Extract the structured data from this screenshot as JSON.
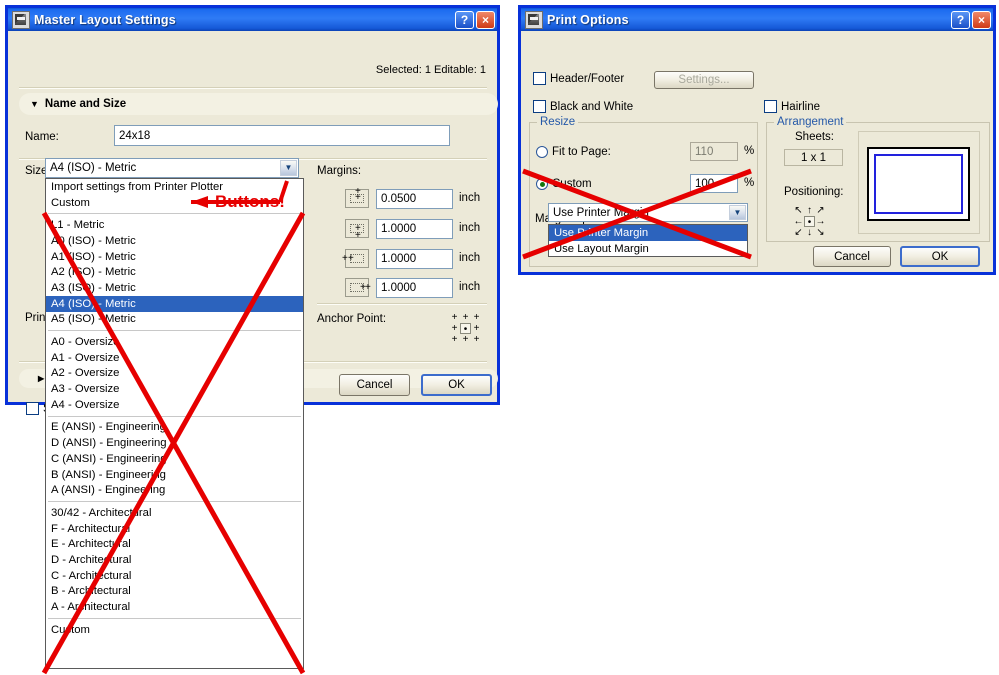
{
  "colors": {
    "accent_blue": "#0831d9",
    "dialog_face": "#ece9d8",
    "selection_blue": "#2c63bd",
    "group_title_blue": "#2458a8",
    "annotation_red": "#e60000",
    "preview_border_blue": "#2222dd"
  },
  "master_layout_dialog": {
    "title": "Master Layout Settings",
    "help_label": "?",
    "close_label": "×",
    "status_text": "Selected: 1 Editable: 1",
    "rollup": {
      "arrow": "▼",
      "label": "Name and Size"
    },
    "name_label": "Name:",
    "name_value": "24x18",
    "size_label": "Size:",
    "size_selected": "A4 (ISO) - Metric",
    "size_options": [
      "Import settings from Printer Plotter",
      "Custom",
      "L1 - Metric",
      "A0 (ISO) - Metric",
      "A1 (ISO) - Metric",
      "A2 (ISO) - Metric",
      "A3 (ISO) - Metric",
      "A4 (ISO) - Metric",
      "A5 (ISO) - Metric",
      "A0 - Oversize",
      "A1 - Oversize",
      "A2 - Oversize",
      "A3 - Oversize",
      "A4 - Oversize",
      "E (ANSI) - Engineering",
      "D (ANSI) - Engineering",
      "C (ANSI) - Engineering",
      "B (ANSI) - Engineering",
      "A (ANSI) - Engineering",
      "30/42 - Architectural",
      "F - Architectural",
      "E - Architectural",
      "D - Architectural",
      "C - Architectural",
      "B - Architectural",
      "A - Architectural",
      "Custom"
    ],
    "margins_label": "Margins:",
    "margins": [
      {
        "icon": "margin-top-icon",
        "value": "0.0500",
        "unit": "inch"
      },
      {
        "icon": "margin-bottom-icon",
        "value": "1.0000",
        "unit": "inch"
      },
      {
        "icon": "margin-left-icon",
        "value": "1.0000",
        "unit": "inch"
      },
      {
        "icon": "margin-right-icon",
        "value": "1.0000",
        "unit": "inch"
      }
    ],
    "anchor_label": "Anchor Point:",
    "printer_label": "Print",
    "collapsed_arrow": "▶",
    "bottom_checkbox_label": "S",
    "cancel_label": "Cancel",
    "ok_label": "OK"
  },
  "print_options_dialog": {
    "title": "Print Options",
    "help_label": "?",
    "close_label": "×",
    "header_footer_label": "Header/Footer",
    "settings_label": "Settings...",
    "black_and_white_label": "Black and White",
    "hairline_label": "Hairline",
    "resize_group": "Resize",
    "fit_to_page_label": "Fit to Page:",
    "fit_to_page_value": "110",
    "fit_to_page_unit": "%",
    "custom_label": "Custom",
    "custom_value": "100",
    "custom_unit": "%",
    "margin_options_label": "Margin Options:",
    "margin_options_selected": "Use Printer Margin",
    "margin_options_list": [
      "Use Printer Margin",
      "Use Layout Margin"
    ],
    "arrangement_group": "Arrangement",
    "sheets_label": "Sheets:",
    "sheets_value": "1 x 1",
    "positioning_label": "Positioning:",
    "cancel_label": "Cancel",
    "ok_label": "OK"
  },
  "annotations": {
    "buttons_callout": "Buttons!"
  }
}
